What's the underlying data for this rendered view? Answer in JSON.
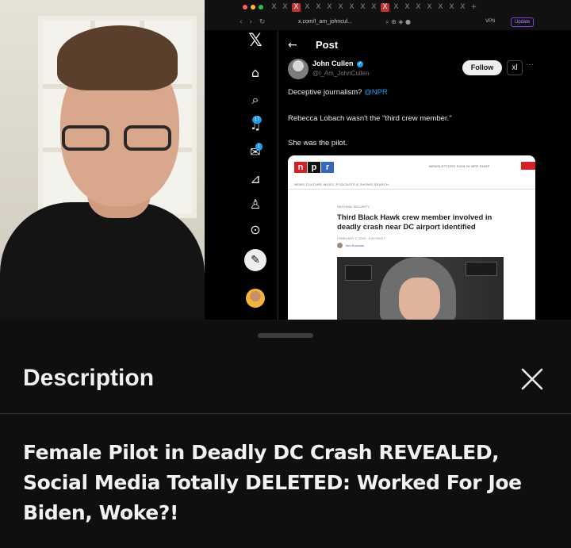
{
  "browser": {
    "url": "x.com/I_am_johncul...",
    "vpn_label": "VPN",
    "update_label": "Update",
    "tab_glyphs": [
      "X",
      "X",
      "X",
      "X",
      "X",
      "X",
      "X",
      "X",
      "X",
      "X",
      "X",
      "X",
      "X",
      "X",
      "X",
      "X",
      "X",
      "X",
      "+"
    ]
  },
  "x_sidebar": {
    "notifications_badge": "17",
    "messages_badge": "1",
    "icons": [
      "x-logo-icon",
      "home-icon",
      "search-icon",
      "notifications-icon",
      "messages-icon",
      "grok-icon",
      "profile-icon",
      "more-icon",
      "post-icon"
    ]
  },
  "post": {
    "header": "Post",
    "author_name": "John Cullen",
    "author_handle": "@I_Am_JohnCullen",
    "follow_label": "Follow",
    "grok_label": "xl",
    "more_label": "···",
    "text_line1_prefix": "Deceptive journalism?",
    "text_line1_mention": "@NPR",
    "text_line2": "Rebecca Lobach wasn't the \"third crew member.\"",
    "text_line3": "She was the pilot."
  },
  "npr_article": {
    "logo_letters": [
      "n",
      "p",
      "r"
    ],
    "top_links": "NEWSLETTERS   SIGN IN   NPR SHOP",
    "nav": "NEWS   CULTURE   MUSIC   PODCASTS & SHOWS   SEARCH",
    "kicker": "NATIONAL SECURITY",
    "headline": "Third Black Hawk crew member involved in deadly crash near DC airport identified",
    "date": "FEBRUARY 1, 2025 · 5:50 PM ET",
    "byline": "Tom Bowman"
  },
  "description_sheet": {
    "title": "Description",
    "video_title": "Female Pilot in Deadly DC Crash REVEALED, Social Media Totally DELETED: Worked For Joe Biden, Woke?!"
  },
  "colors": {
    "background": "#0f0f0f",
    "x_blue": "#1d9bf0",
    "npr_red": "#d62021",
    "npr_black": "#111111",
    "npr_blue": "#3466c2"
  }
}
